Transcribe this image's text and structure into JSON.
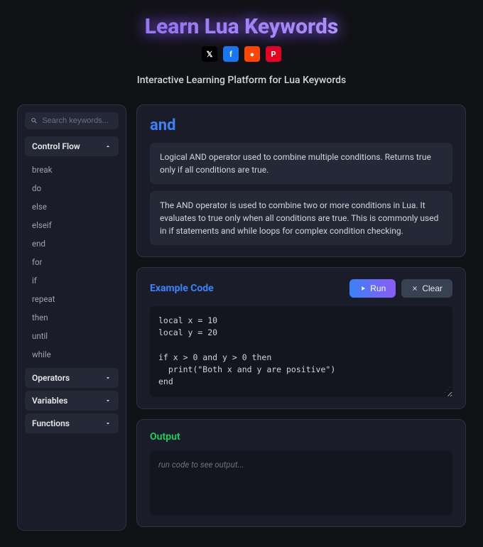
{
  "header": {
    "title": "Learn Lua Keywords",
    "subtitle": "Interactive Learning Platform for Lua Keywords"
  },
  "social": [
    {
      "name": "x",
      "label": "𝕏"
    },
    {
      "name": "facebook",
      "label": "f"
    },
    {
      "name": "reddit",
      "label": "●"
    },
    {
      "name": "pinterest",
      "label": "P"
    }
  ],
  "search": {
    "placeholder": "Search keywords..."
  },
  "categories": [
    {
      "name": "Control Flow",
      "expanded": true,
      "keywords": [
        "break",
        "do",
        "else",
        "elseif",
        "end",
        "for",
        "if",
        "repeat",
        "then",
        "until",
        "while"
      ]
    },
    {
      "name": "Operators",
      "expanded": false
    },
    {
      "name": "Variables",
      "expanded": false
    },
    {
      "name": "Functions",
      "expanded": false
    }
  ],
  "detail": {
    "keyword": "and",
    "short_desc": "Logical AND operator used to combine multiple conditions. Returns true only if all conditions are true.",
    "long_desc": "The AND operator is used to combine two or more conditions in Lua. It evaluates to true only when all conditions are true. This is commonly used in if statements and while loops for complex condition checking."
  },
  "example": {
    "title": "Example Code",
    "run_label": "Run",
    "clear_label": "Clear",
    "code": "local x = 10\nlocal y = 20\n\nif x > 0 and y > 0 then\n  print(\"Both x and y are positive\")\nend"
  },
  "output": {
    "title": "Output",
    "placeholder": "run code to see output..."
  }
}
